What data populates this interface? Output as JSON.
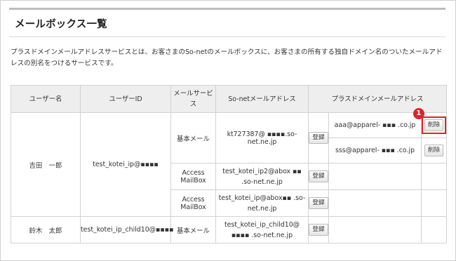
{
  "page": {
    "title": "メールボックス一覧",
    "description": "プラスドメインメールアドレスサービスとは、お客さまのSo-netのメールボックスに、お客さまの所有する独自ドメイン名のついたメールアドレスの別名をつけるサービスです。"
  },
  "table": {
    "headers": {
      "user_name": "ユーザー名",
      "user_id": "ユーザーID",
      "mail_service": "メールサービス",
      "sonet_address": "So-netメールアドレス",
      "plus_address": "プラスドメインメールアドレス"
    },
    "register_label": "登録",
    "delete_label": "削除",
    "callout_number": "1",
    "user1": {
      "name": "吉田　一郎",
      "id": "test_kotei_ip@▪▪▪▪",
      "row1": {
        "service": "基本メール",
        "address": "kt727387@ ▪▪▪▪.so-net.ne.jp",
        "plus1": "aaa@apparel- ▪▪▪ .co.jp",
        "plus2": "sss@apparel- ▪▪▪ .co.jp"
      },
      "row2": {
        "service": "Access MailBox",
        "address": "test_kotei_ip2@abox ▪▪ .so-net.ne.jp"
      },
      "row3": {
        "service": "Access MailBox",
        "address": "test_kotei_ip@abox▪▪ .so-net.ne.jp"
      }
    },
    "user2": {
      "name": "鈴木　太郎",
      "id": "test_kotei_ip_child10@▪▪▪▪",
      "row1": {
        "service": "基本メール",
        "address": "test_kotei_ip_child10@ ▪▪▪▪ .so-net.ne.jp"
      }
    }
  }
}
